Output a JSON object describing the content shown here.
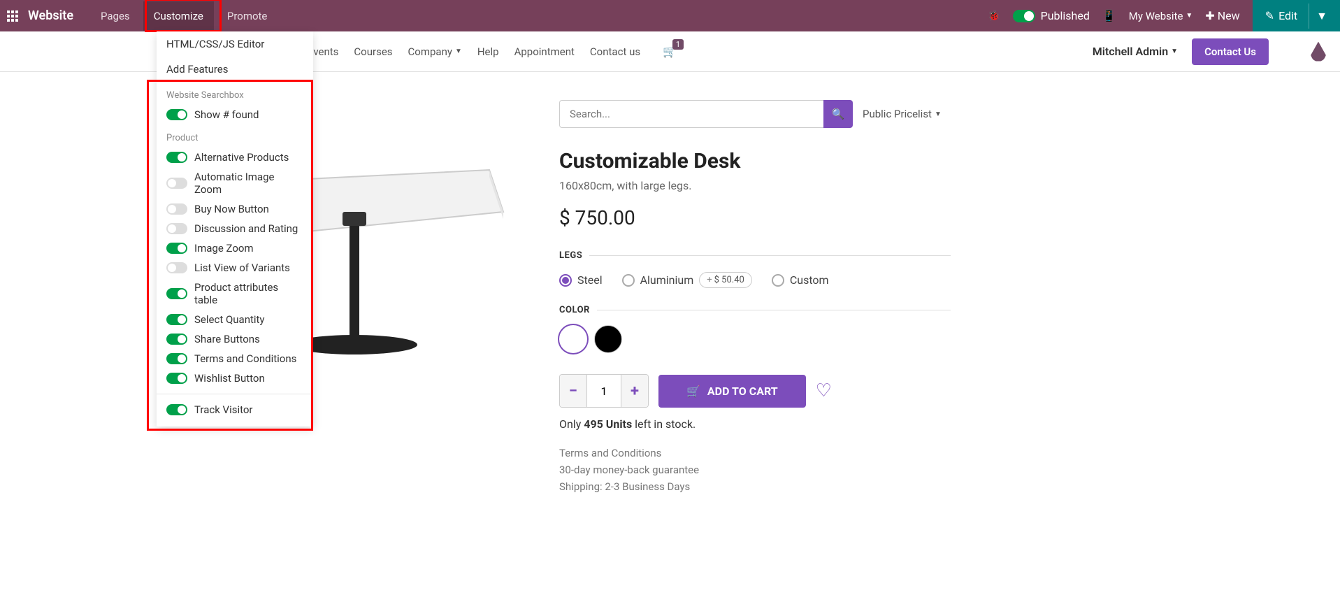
{
  "topbar": {
    "brand": "Website",
    "menu": {
      "pages": "Pages",
      "customize": "Customize",
      "promote": "Promote"
    },
    "published": "Published",
    "my_website": "My Website",
    "new": "New",
    "edit": "Edit"
  },
  "secondary_nav": {
    "events": "Events",
    "courses": "Courses",
    "company": "Company",
    "help": "Help",
    "appointment": "Appointment",
    "contact": "Contact us",
    "cart_count": "1",
    "user": "Mitchell Admin",
    "contact_btn": "Contact Us"
  },
  "dropdown": {
    "html_editor": "HTML/CSS/JS Editor",
    "add_features": "Add Features",
    "section_search": "Website Searchbox",
    "show_found": "Show # found",
    "section_product": "Product",
    "options": {
      "alt_products": "Alternative Products",
      "auto_zoom": "Automatic Image Zoom",
      "buy_now": "Buy Now Button",
      "discussion": "Discussion and Rating",
      "image_zoom": "Image Zoom",
      "list_variants": "List View of Variants",
      "attr_table": "Product attributes table",
      "select_qty": "Select Quantity",
      "share": "Share Buttons",
      "terms": "Terms and Conditions",
      "wishlist": "Wishlist Button",
      "track": "Track Visitor"
    }
  },
  "search": {
    "placeholder": "Search...",
    "pricelist": "Public Pricelist"
  },
  "product": {
    "title": "Customizable Desk",
    "subtitle": "160x80cm, with large legs.",
    "price": "$ 750.00",
    "legs_label": "LEGS",
    "legs": {
      "steel": "Steel",
      "aluminium": "Aluminium",
      "custom": "Custom",
      "alu_extra": "$ 50.40"
    },
    "color_label": "COLOR",
    "qty": "1",
    "add_to_cart": "ADD TO CART",
    "stock_prefix": "Only ",
    "stock_count": "495 Units",
    "stock_suffix": " left in stock.",
    "terms1": "Terms and Conditions",
    "terms2": "30-day money-back guarantee",
    "terms3": "Shipping: 2-3 Business Days"
  }
}
